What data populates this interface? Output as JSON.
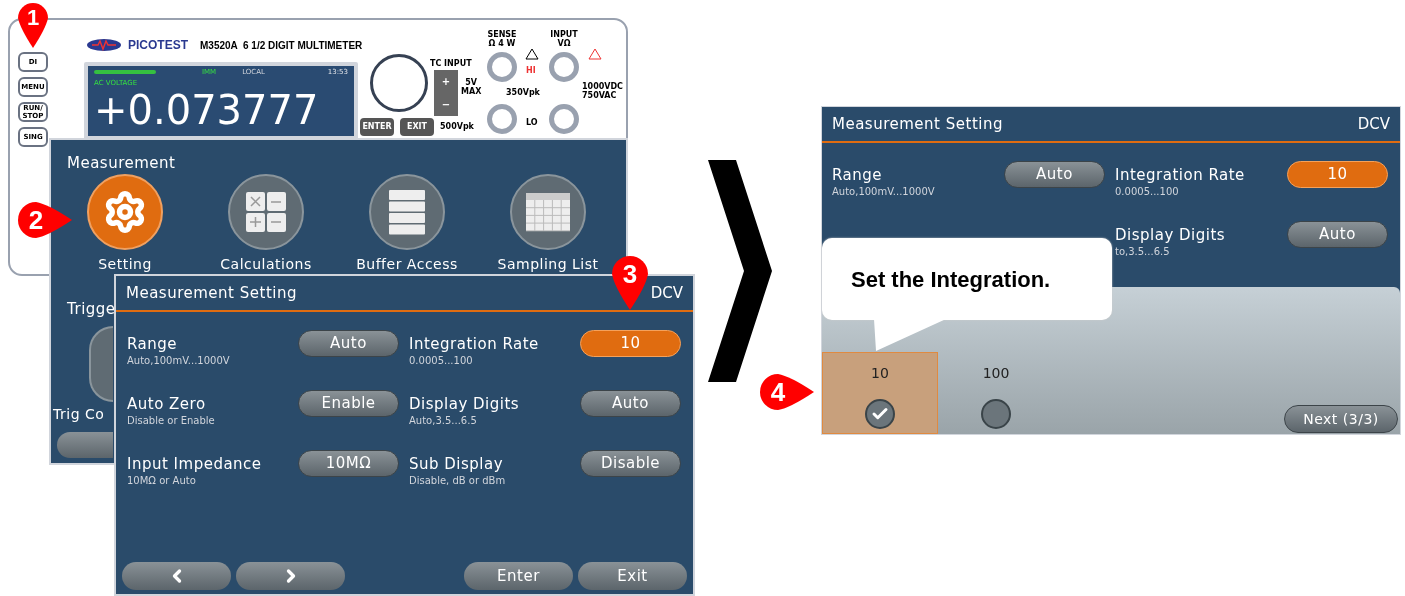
{
  "device": {
    "brand": "PICOTEST",
    "model": "M3520A  6 1/2 DIGIT MULTIMETER",
    "side_buttons": [
      {
        "lines": [
          "DI"
        ]
      },
      {
        "lines": [
          "MENU"
        ]
      },
      {
        "lines": [
          "RUN/",
          "STOP"
        ]
      },
      {
        "lines": [
          "SING"
        ]
      }
    ],
    "display": {
      "status": "IMM",
      "mode": "LOCAL",
      "time": "13:53",
      "function": "AC VOLTAGE",
      "reading": "+0.073777"
    },
    "keys": [
      "ENTER",
      "EXIT"
    ],
    "tc_input": {
      "title": "TC INPUT",
      "plus": "+",
      "minus": "−",
      "limit": "5V\nMAX",
      "peak": "500Vpk"
    },
    "sense": {
      "title": "SENSE",
      "sub": "Ω 4 W"
    },
    "input": {
      "title": "INPUT",
      "sub": "VΩ"
    },
    "hi": "HI",
    "lo": "LO",
    "mid_rating": "350Vpk",
    "rating": [
      "1000VDC",
      "750VAC"
    ]
  },
  "menu_window": {
    "title": "Measurement",
    "items": [
      {
        "label": "Setting",
        "kind": "gear",
        "selected": true
      },
      {
        "label": "Calculations",
        "kind": "calculator",
        "selected": false
      },
      {
        "label": "Buffer Access",
        "kind": "stack",
        "selected": false
      },
      {
        "label": "Sampling List",
        "kind": "table",
        "selected": false
      }
    ],
    "section": "Trigge",
    "second_row_label": "Trig Co"
  },
  "setting_window": {
    "title": "Measurement Setting",
    "mode": "DCV",
    "left_column": [
      {
        "label": "Range",
        "hint": "Auto,100mV...1000V",
        "value": "Auto",
        "selected": false
      },
      {
        "label": "Auto Zero",
        "hint": "Disable or Enable",
        "value": "Enable",
        "selected": false
      },
      {
        "label": "Input Impedance",
        "hint": "10MΩ or Auto",
        "value": "10MΩ",
        "selected": false
      }
    ],
    "right_column": [
      {
        "label": "Integration Rate",
        "hint": "0.0005...100",
        "value": "10",
        "selected": true
      },
      {
        "label": "Display Digits",
        "hint": "Auto,3.5...6.5",
        "value": "Auto",
        "selected": false
      },
      {
        "label": "Sub Display",
        "hint": "Disable, dB or dBm",
        "value": "Disable",
        "selected": false
      }
    ],
    "buttons": [
      "Enter",
      "Exit"
    ]
  },
  "result_window": {
    "title": "Measurement Setting",
    "mode": "DCV",
    "left_column": [
      {
        "label": "Range",
        "hint": "Auto,100mV...1000V",
        "value": "Auto",
        "selected": false
      }
    ],
    "right_column": [
      {
        "label": "Integration Rate",
        "hint": "0.0005...100",
        "value": "10",
        "selected": true
      },
      {
        "label": "Display Digits",
        "hint": "to,3.5...6.5",
        "value": "Auto",
        "selected": false
      }
    ],
    "options": [
      {
        "label": "10",
        "selected": true
      },
      {
        "label": "100",
        "selected": false
      }
    ],
    "next_button": "Next (3/3)"
  },
  "callout": "Set the Integration.",
  "step_markers": [
    "1",
    "2",
    "3",
    "4"
  ]
}
